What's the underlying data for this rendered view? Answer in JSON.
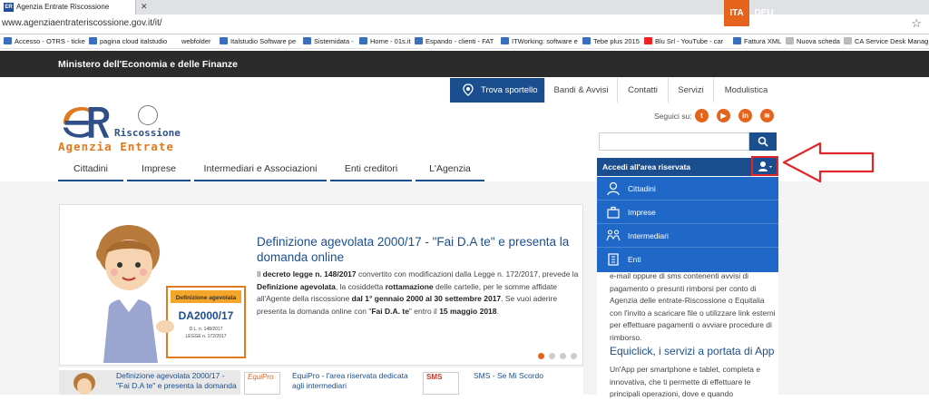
{
  "browser": {
    "tab_title": "Agenzia Entrate Riscossione",
    "favicon_text": "ER",
    "url": "www.agenziaentrateriscossione.gov.it/it/",
    "bookmarks": [
      "Accesso - OTRS - ticke",
      "pagina cloud italstudio",
      "webfolder",
      "Italstudio Software pe",
      "Sistemidata -",
      "Home - 01s.it",
      "Espando - clienti - FAT",
      "ITWorking: software e",
      "Tebe plus 2015",
      "Blu Srl - YouTube - car",
      "Fattura XML",
      "Nuova scheda",
      "CA Service Desk Manag"
    ]
  },
  "header": {
    "ministry": "Ministero dell'Economia e delle Finanze",
    "lang_active": "ITA",
    "lang_other": "DEU",
    "topnav": [
      "Trova sportello",
      "Bandi & Avvisi",
      "Contatti",
      "Servizi",
      "Modulistica"
    ],
    "logo_riscossione": "Riscossione",
    "logo_agenzia": "Agenzia Entrate",
    "seguici": "Seguici su:",
    "social": [
      "t",
      "▶",
      "in",
      "≋"
    ],
    "mainnav": [
      "Cittadini",
      "Imprese",
      "Intermediari e Associazioni",
      "Enti creditori",
      "L'Agenzia"
    ]
  },
  "area": {
    "label": "Accedi all'area riservata",
    "items": [
      "Cittadini",
      "Imprese",
      "Intermediari",
      "Enti"
    ]
  },
  "slide": {
    "title": "Definizione agevolata 2000/17 - \"Fai D.A te\" e presenta la domanda online",
    "text_1": "Il ",
    "text_2": "decreto legge n. 148/2017",
    "text_3": " convertito con modificazioni dalla Legge n. 172/2017, prevede la ",
    "text_4": "Definizione agevolata",
    "text_5": ", la cosiddetta ",
    "text_6": "rottamazione",
    "text_7": " delle cartelle, per le somme affidate all'Agente della riscossione ",
    "text_8": "dal 1° gennaio 2000 al 30 settembre 2017",
    "text_9": ". Se vuoi aderire presenta la domanda online con \"",
    "text_10": "Fai D.A. te",
    "text_11": "\" entro il ",
    "text_12": "15 maggio 2018",
    "text_13": ".",
    "poster_title": "Definizione agevolata",
    "poster_big": "DA2000/17",
    "poster_line1": "D.L. n. 148/2017",
    "poster_line2": "LEGGE n. 172/2017"
  },
  "thumbs": [
    {
      "title": "Definizione agevolata 2000/17 - \"Fai D.A te\" e presenta la domanda"
    },
    {
      "title": "EquiPro - l'area riservata dedicata agli intermediari",
      "img_text": "EquiPro"
    },
    {
      "title": "SMS - Se Mi Scordo",
      "img_text": "SMS"
    }
  ],
  "right": {
    "text": "e-mail oppure di sms contenenti avvisi di pagamento o presunti rimborsi per conto di Agenzia delle entrate-Riscossione o Equitalia con l'invito a scaricare file o utilizzare link esterni per effettuare pagamenti o avviare procedure di rimborso.",
    "title": "Equiclick, i servizi a portata di App",
    "text2": "Un'App per smartphone e tablet, completa e innovativa, che ti permette di effettuare le principali operazioni, dove e quando"
  },
  "colors": {
    "brand_blue": "#1b4e8f",
    "dropdown_blue": "#2068c8",
    "orange": "#e5631b",
    "highlight_red": "#e0262b"
  }
}
